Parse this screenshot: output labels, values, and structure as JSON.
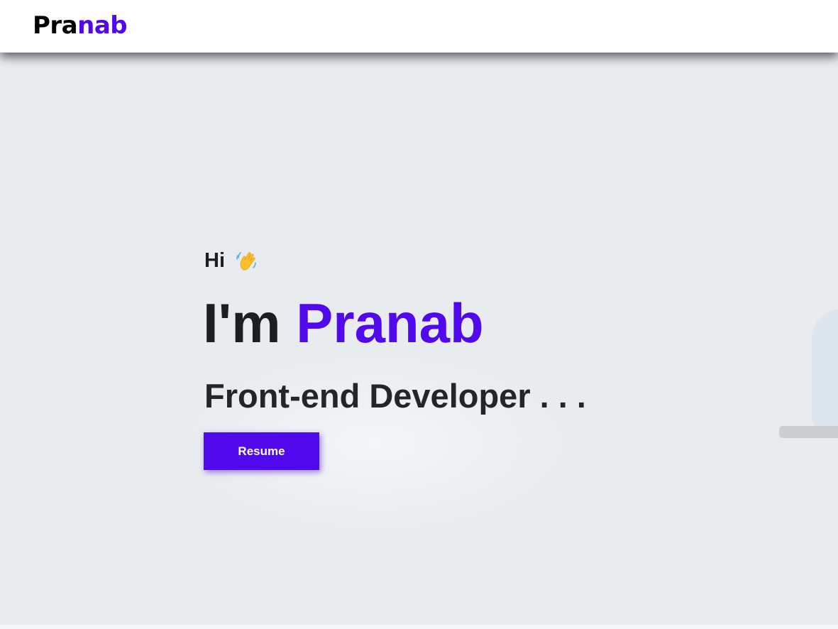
{
  "nav": {
    "logo_part1": "Pra",
    "logo_part2": "nab"
  },
  "hero": {
    "greeting": "Hi",
    "greeting_icon": "waving-hand-icon",
    "headline_prefix": "I'm",
    "headline_name": "Pranab",
    "role": "Front-end Developer . . .",
    "resume_label": "Resume"
  },
  "colors": {
    "accent": "#5108ec",
    "hero_background": "#e8ecef",
    "text_dark": "#1c1f22"
  }
}
